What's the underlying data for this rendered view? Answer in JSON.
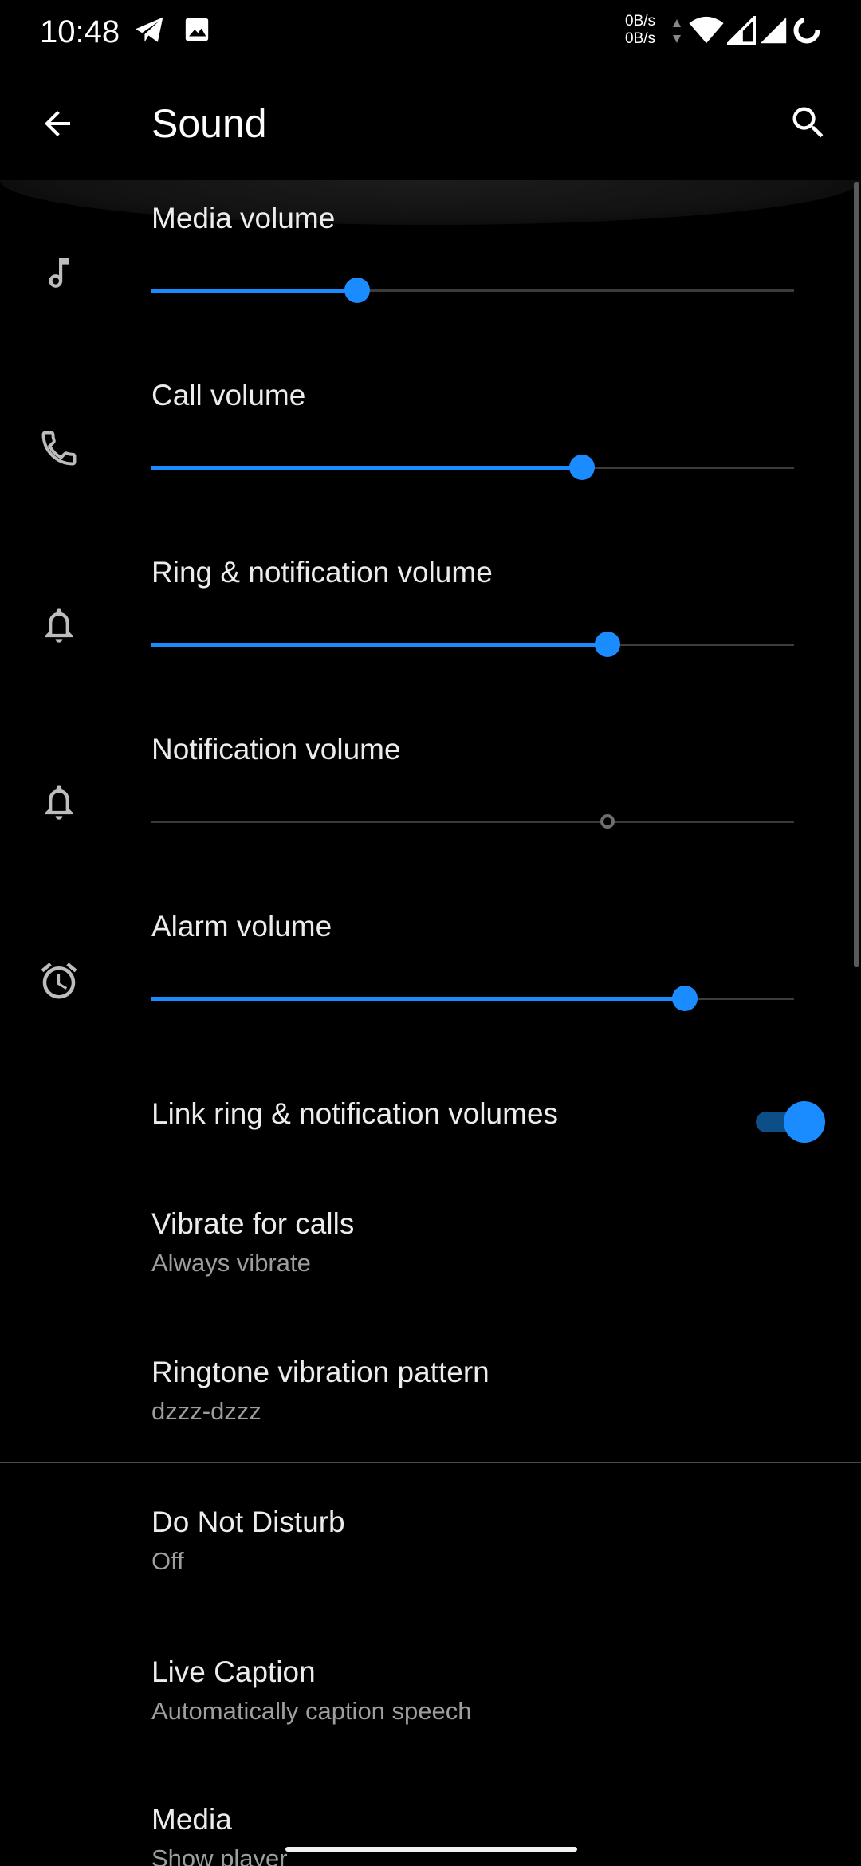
{
  "status_bar": {
    "time": "10:48",
    "net_up": "0B/s",
    "net_down": "0B/s",
    "icons": [
      "telegram-icon",
      "image-icon",
      "data-arrows-icon",
      "wifi-icon",
      "signal-icon",
      "signal-icon",
      "battery-ring-icon"
    ]
  },
  "app_bar": {
    "title": "Sound",
    "back_icon": "arrow-left-icon",
    "search_icon": "search-icon"
  },
  "colors": {
    "accent": "#1a8cff",
    "background": "#000000",
    "text_primary": "#ececec",
    "text_secondary": "#9e9e9e"
  },
  "volumes": [
    {
      "label": "Media volume",
      "icon": "music-note-icon",
      "level_percent": 32,
      "enabled": true
    },
    {
      "label": "Call volume",
      "icon": "phone-icon",
      "level_percent": 67,
      "enabled": true
    },
    {
      "label": "Ring & notification volume",
      "icon": "bell-icon",
      "level_percent": 71,
      "enabled": true
    },
    {
      "label": "Notification volume",
      "icon": "bell-icon",
      "level_percent": 71,
      "enabled": false
    },
    {
      "label": "Alarm volume",
      "icon": "alarm-clock-icon",
      "level_percent": 83,
      "enabled": true
    }
  ],
  "link_volumes": {
    "label": "Link ring & notification volumes",
    "checked": true
  },
  "prefs": [
    {
      "title": "Vibrate for calls",
      "subtitle": "Always vibrate"
    },
    {
      "title": "Ringtone vibration pattern",
      "subtitle": "dzzz-dzzz"
    },
    {
      "title": "Do Not Disturb",
      "subtitle": "Off"
    },
    {
      "title": "Live Caption",
      "subtitle": "Automatically caption speech"
    },
    {
      "title": "Media",
      "subtitle": "Show player"
    }
  ]
}
